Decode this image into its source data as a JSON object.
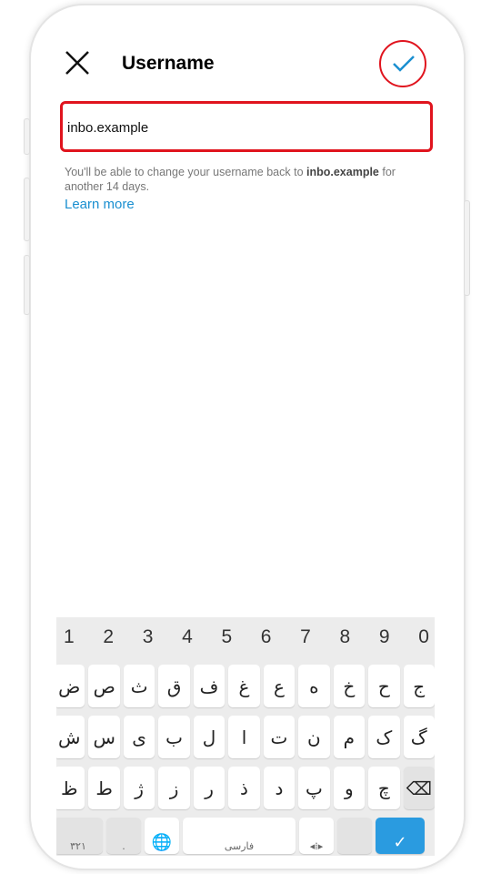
{
  "header": {
    "title": "Username"
  },
  "username_field": {
    "value": "inbo.example"
  },
  "help": {
    "prefix": "You'll be able to change your username back to ",
    "username": "inbo.example",
    "suffix": " for another 14 days.",
    "learn_more": "Learn more"
  },
  "colors": {
    "accent": "#1a8fd0",
    "highlight": "#e0141e",
    "enter": "#2a9be0"
  },
  "keyboard": {
    "numbers": [
      "1",
      "2",
      "3",
      "4",
      "5",
      "6",
      "7",
      "8",
      "9",
      "0"
    ],
    "row1": [
      "ض",
      "ص",
      "ث",
      "ق",
      "ف",
      "غ",
      "ع",
      "ه",
      "خ",
      "ح",
      "ج"
    ],
    "row2": [
      "ش",
      "س",
      "ی",
      "ب",
      "ل",
      "ا",
      "ت",
      "ن",
      "م",
      "ک",
      "گ"
    ],
    "row3": [
      "ظ",
      "ط",
      "ژ",
      "ز",
      "ر",
      "ذ",
      "د",
      "پ",
      "و",
      "چ"
    ],
    "bottom": {
      "symbols": "۳۲۱",
      "period": ".",
      "space": "فارسی"
    }
  }
}
